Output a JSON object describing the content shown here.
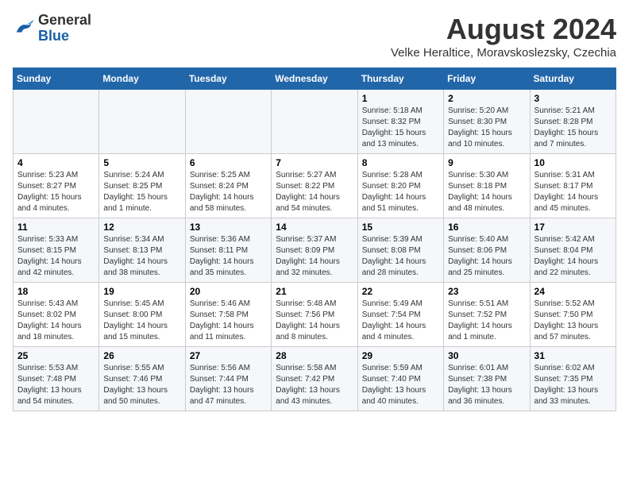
{
  "header": {
    "logo_general": "General",
    "logo_blue": "Blue",
    "month_year": "August 2024",
    "location": "Velke Heraltice, Moravskoslezsky, Czechia"
  },
  "days_of_week": [
    "Sunday",
    "Monday",
    "Tuesday",
    "Wednesday",
    "Thursday",
    "Friday",
    "Saturday"
  ],
  "weeks": [
    {
      "days": [
        {
          "number": "",
          "info": ""
        },
        {
          "number": "",
          "info": ""
        },
        {
          "number": "",
          "info": ""
        },
        {
          "number": "",
          "info": ""
        },
        {
          "number": "1",
          "info": "Sunrise: 5:18 AM\nSunset: 8:32 PM\nDaylight: 15 hours\nand 13 minutes."
        },
        {
          "number": "2",
          "info": "Sunrise: 5:20 AM\nSunset: 8:30 PM\nDaylight: 15 hours\nand 10 minutes."
        },
        {
          "number": "3",
          "info": "Sunrise: 5:21 AM\nSunset: 8:28 PM\nDaylight: 15 hours\nand 7 minutes."
        }
      ]
    },
    {
      "days": [
        {
          "number": "4",
          "info": "Sunrise: 5:23 AM\nSunset: 8:27 PM\nDaylight: 15 hours\nand 4 minutes."
        },
        {
          "number": "5",
          "info": "Sunrise: 5:24 AM\nSunset: 8:25 PM\nDaylight: 15 hours\nand 1 minute."
        },
        {
          "number": "6",
          "info": "Sunrise: 5:25 AM\nSunset: 8:24 PM\nDaylight: 14 hours\nand 58 minutes."
        },
        {
          "number": "7",
          "info": "Sunrise: 5:27 AM\nSunset: 8:22 PM\nDaylight: 14 hours\nand 54 minutes."
        },
        {
          "number": "8",
          "info": "Sunrise: 5:28 AM\nSunset: 8:20 PM\nDaylight: 14 hours\nand 51 minutes."
        },
        {
          "number": "9",
          "info": "Sunrise: 5:30 AM\nSunset: 8:18 PM\nDaylight: 14 hours\nand 48 minutes."
        },
        {
          "number": "10",
          "info": "Sunrise: 5:31 AM\nSunset: 8:17 PM\nDaylight: 14 hours\nand 45 minutes."
        }
      ]
    },
    {
      "days": [
        {
          "number": "11",
          "info": "Sunrise: 5:33 AM\nSunset: 8:15 PM\nDaylight: 14 hours\nand 42 minutes."
        },
        {
          "number": "12",
          "info": "Sunrise: 5:34 AM\nSunset: 8:13 PM\nDaylight: 14 hours\nand 38 minutes."
        },
        {
          "number": "13",
          "info": "Sunrise: 5:36 AM\nSunset: 8:11 PM\nDaylight: 14 hours\nand 35 minutes."
        },
        {
          "number": "14",
          "info": "Sunrise: 5:37 AM\nSunset: 8:09 PM\nDaylight: 14 hours\nand 32 minutes."
        },
        {
          "number": "15",
          "info": "Sunrise: 5:39 AM\nSunset: 8:08 PM\nDaylight: 14 hours\nand 28 minutes."
        },
        {
          "number": "16",
          "info": "Sunrise: 5:40 AM\nSunset: 8:06 PM\nDaylight: 14 hours\nand 25 minutes."
        },
        {
          "number": "17",
          "info": "Sunrise: 5:42 AM\nSunset: 8:04 PM\nDaylight: 14 hours\nand 22 minutes."
        }
      ]
    },
    {
      "days": [
        {
          "number": "18",
          "info": "Sunrise: 5:43 AM\nSunset: 8:02 PM\nDaylight: 14 hours\nand 18 minutes."
        },
        {
          "number": "19",
          "info": "Sunrise: 5:45 AM\nSunset: 8:00 PM\nDaylight: 14 hours\nand 15 minutes."
        },
        {
          "number": "20",
          "info": "Sunrise: 5:46 AM\nSunset: 7:58 PM\nDaylight: 14 hours\nand 11 minutes."
        },
        {
          "number": "21",
          "info": "Sunrise: 5:48 AM\nSunset: 7:56 PM\nDaylight: 14 hours\nand 8 minutes."
        },
        {
          "number": "22",
          "info": "Sunrise: 5:49 AM\nSunset: 7:54 PM\nDaylight: 14 hours\nand 4 minutes."
        },
        {
          "number": "23",
          "info": "Sunrise: 5:51 AM\nSunset: 7:52 PM\nDaylight: 14 hours\nand 1 minute."
        },
        {
          "number": "24",
          "info": "Sunrise: 5:52 AM\nSunset: 7:50 PM\nDaylight: 13 hours\nand 57 minutes."
        }
      ]
    },
    {
      "days": [
        {
          "number": "25",
          "info": "Sunrise: 5:53 AM\nSunset: 7:48 PM\nDaylight: 13 hours\nand 54 minutes."
        },
        {
          "number": "26",
          "info": "Sunrise: 5:55 AM\nSunset: 7:46 PM\nDaylight: 13 hours\nand 50 minutes."
        },
        {
          "number": "27",
          "info": "Sunrise: 5:56 AM\nSunset: 7:44 PM\nDaylight: 13 hours\nand 47 minutes."
        },
        {
          "number": "28",
          "info": "Sunrise: 5:58 AM\nSunset: 7:42 PM\nDaylight: 13 hours\nand 43 minutes."
        },
        {
          "number": "29",
          "info": "Sunrise: 5:59 AM\nSunset: 7:40 PM\nDaylight: 13 hours\nand 40 minutes."
        },
        {
          "number": "30",
          "info": "Sunrise: 6:01 AM\nSunset: 7:38 PM\nDaylight: 13 hours\nand 36 minutes."
        },
        {
          "number": "31",
          "info": "Sunrise: 6:02 AM\nSunset: 7:35 PM\nDaylight: 13 hours\nand 33 minutes."
        }
      ]
    }
  ]
}
